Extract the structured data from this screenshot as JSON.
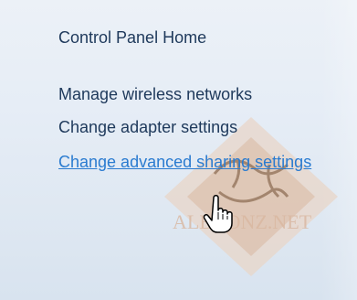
{
  "nav": {
    "items": [
      {
        "label": "Control Panel Home"
      },
      {
        "label": "Manage wireless networks"
      },
      {
        "label": "Change adapter settings"
      },
      {
        "label": "Change advanced sharing settings"
      }
    ]
  },
  "watermark": {
    "text": "ALBRONZ.NET"
  },
  "colors": {
    "link": "#2a7bd0",
    "text": "#1e395b"
  }
}
